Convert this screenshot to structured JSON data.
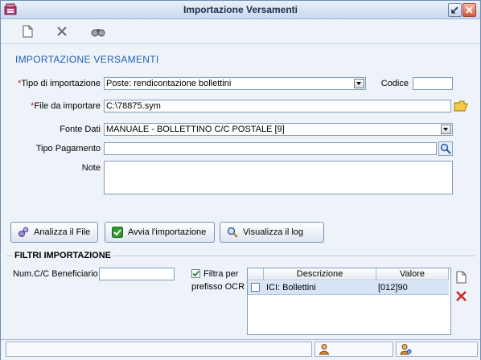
{
  "window": {
    "title": "Importazione Versamenti"
  },
  "toolbar": {
    "icons": [
      "new-document-icon",
      "delete-x-icon",
      "binoculars-icon"
    ]
  },
  "form": {
    "heading": "IMPORTAZIONE VERSAMENTI",
    "tipo_importazione": {
      "label": "Tipo di importazione",
      "value": "Poste: rendicontazione bollettini",
      "required_marker": "*"
    },
    "codice": {
      "label": "Codice",
      "value": ""
    },
    "file_da_importare": {
      "label": "File da importare",
      "value": "C:\\78875.sym",
      "required_marker": "*"
    },
    "fonte_dati": {
      "label": "Fonte Dati",
      "value": "MANUALE - BOLLETTINO C/C POSTALE [9]"
    },
    "tipo_pagamento": {
      "label": "Tipo Pagamento",
      "value": ""
    },
    "note": {
      "label": "Note",
      "value": ""
    }
  },
  "actions": {
    "analizza": "Analizza il File",
    "avvia": "Avvia l'importazione",
    "visualizza": "Visualizza il log"
  },
  "filtri": {
    "title": "FILTRI IMPORTAZIONE",
    "num_cc_label": "Num.C/C Beneficiario",
    "num_cc_value": "",
    "filtra_label_1": "Filtra per",
    "filtra_label_2": "prefisso OCR",
    "filtra_checked": true,
    "grid": {
      "headers": [
        "Descrizione",
        "Valore"
      ],
      "rows": [
        {
          "checked": false,
          "descrizione": "ICI: Bollettini",
          "valore": "[012]90"
        }
      ]
    }
  },
  "colors": {
    "accent": "#1F5FB3",
    "required": "#D01010",
    "window_bg": "#EEF3FA"
  }
}
